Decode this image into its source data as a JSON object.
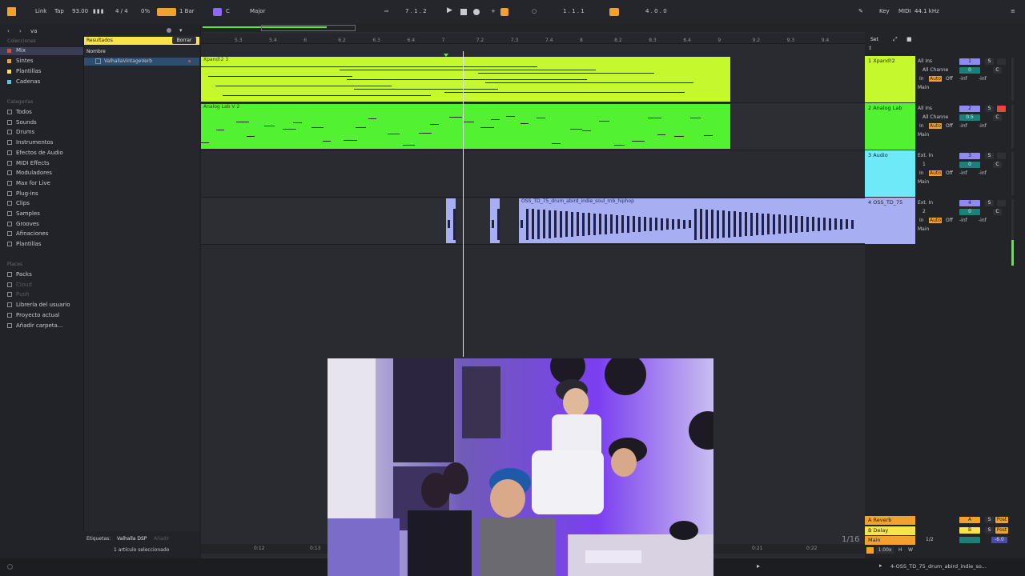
{
  "colors": {
    "lime": "#c6f82e",
    "green": "#52f232",
    "cyan": "#6ee9f7",
    "lavender": "#a8aef2",
    "orange": "#f2a12e",
    "yellow": "#f9e34a",
    "playhead": "#e0e0e6"
  },
  "transport": {
    "link": "Link",
    "tap": "Tap",
    "tempo": "93.00",
    "signature": "4 / 4",
    "swing": "0%",
    "quantize": "1 Bar",
    "key": "C",
    "scale": "Major",
    "position": "7 . 1 . 2",
    "loop_start": "1 . 1 . 1",
    "loop_length": "4 . 0 . 0",
    "key_map": "Key",
    "midi_map": "MIDI",
    "sample_rate": "44.1 kHz"
  },
  "browser": {
    "search_value": "va",
    "collections_title": "Colecciones",
    "collections": [
      {
        "label": "Mix",
        "color": "#e8463a"
      },
      {
        "label": "Sintes",
        "color": "#f2a12e"
      },
      {
        "label": "Plantillas",
        "color": "#f9e34a"
      },
      {
        "label": "Cadenas",
        "color": "#52c6f2"
      }
    ],
    "categories_title": "Categorías",
    "categories": [
      "Todos",
      "Sounds",
      "Drums",
      "Instrumentos",
      "Efectos de Audio",
      "MIDI Effects",
      "Moduladores",
      "Max for Live",
      "Plug-ins",
      "Clips",
      "Samples",
      "Grooves",
      "Afinaciones",
      "Plantillas"
    ],
    "places_title": "Places",
    "places": [
      "Packs",
      "Cloud",
      "Push",
      "Librería del usuario",
      "Proyecto actual",
      "Añadir carpeta..."
    ],
    "results_label": "Resultados",
    "clear_label": "Borrar",
    "name_header": "Nombre",
    "results": [
      "ValhallaVintageVerb"
    ],
    "tags_label": "Etiquetas:",
    "tag_value": "Valhalla DSP",
    "tag_add": "Añadir",
    "selection_status": "1 artículo seleccionado"
  },
  "ruler": [
    "5.3",
    "5.4",
    "6",
    "6.2",
    "6.3",
    "6.4",
    "7",
    "7.2",
    "7.3",
    "7.4",
    "8",
    "8.2",
    "8.3",
    "8.4",
    "9",
    "9.2",
    "9.3",
    "9.4"
  ],
  "ruler_bottom": [
    "0:12",
    "0:13",
    "0:21",
    "0:22"
  ],
  "set_label": "Set",
  "grid_label": "1/16",
  "tracks": [
    {
      "name": "1 Xpand!2",
      "clip": "Xpand!2 3",
      "color": "#c6f82e",
      "input": "All Ins",
      "channel": "All Channe",
      "monitor": "Auto",
      "out": "Main",
      "num": "1",
      "vol": "0"
    },
    {
      "name": "2 Analog Lab",
      "clip": "Analog Lab V 2",
      "color": "#52f232",
      "input": "All Ins",
      "channel": "All Channe",
      "monitor": "Auto",
      "out": "Main",
      "num": "2",
      "vol": "0.5"
    },
    {
      "name": "3 Audio",
      "clip": "",
      "color": "#6ee9f7",
      "input": "Ext. In",
      "channel": "1",
      "monitor": "Auto",
      "out": "Main",
      "num": "3",
      "vol": "0"
    },
    {
      "name": "4 OSS_TD_75",
      "clip": "OSS_TD_75_drum_abird_indie_soul_rnb_hiphop",
      "color": "#a8aef2",
      "input": "Ext. In",
      "channel": "2",
      "monitor": "Auto",
      "out": "Main",
      "num": "4",
      "vol": "0"
    }
  ],
  "monitor_in": "In",
  "monitor_off": "Off",
  "pan": "C",
  "vol_inf": "-inf",
  "returns": [
    {
      "name": "A Reverb",
      "color": "#f2a12e",
      "letter": "A"
    },
    {
      "name": "B Delay",
      "color": "#f9e34a",
      "letter": "B"
    },
    {
      "name": "Main",
      "color": "#f2a12e",
      "letter": "",
      "ratio": "1/2",
      "vol": "-6.0"
    }
  ],
  "main_buttons": {
    "zoom": "1.00x",
    "h": "H",
    "w": "W"
  },
  "status_clip": "4-OSS_TD_75_drum_abird_indie_so...",
  "solo": "S",
  "post": "Post"
}
